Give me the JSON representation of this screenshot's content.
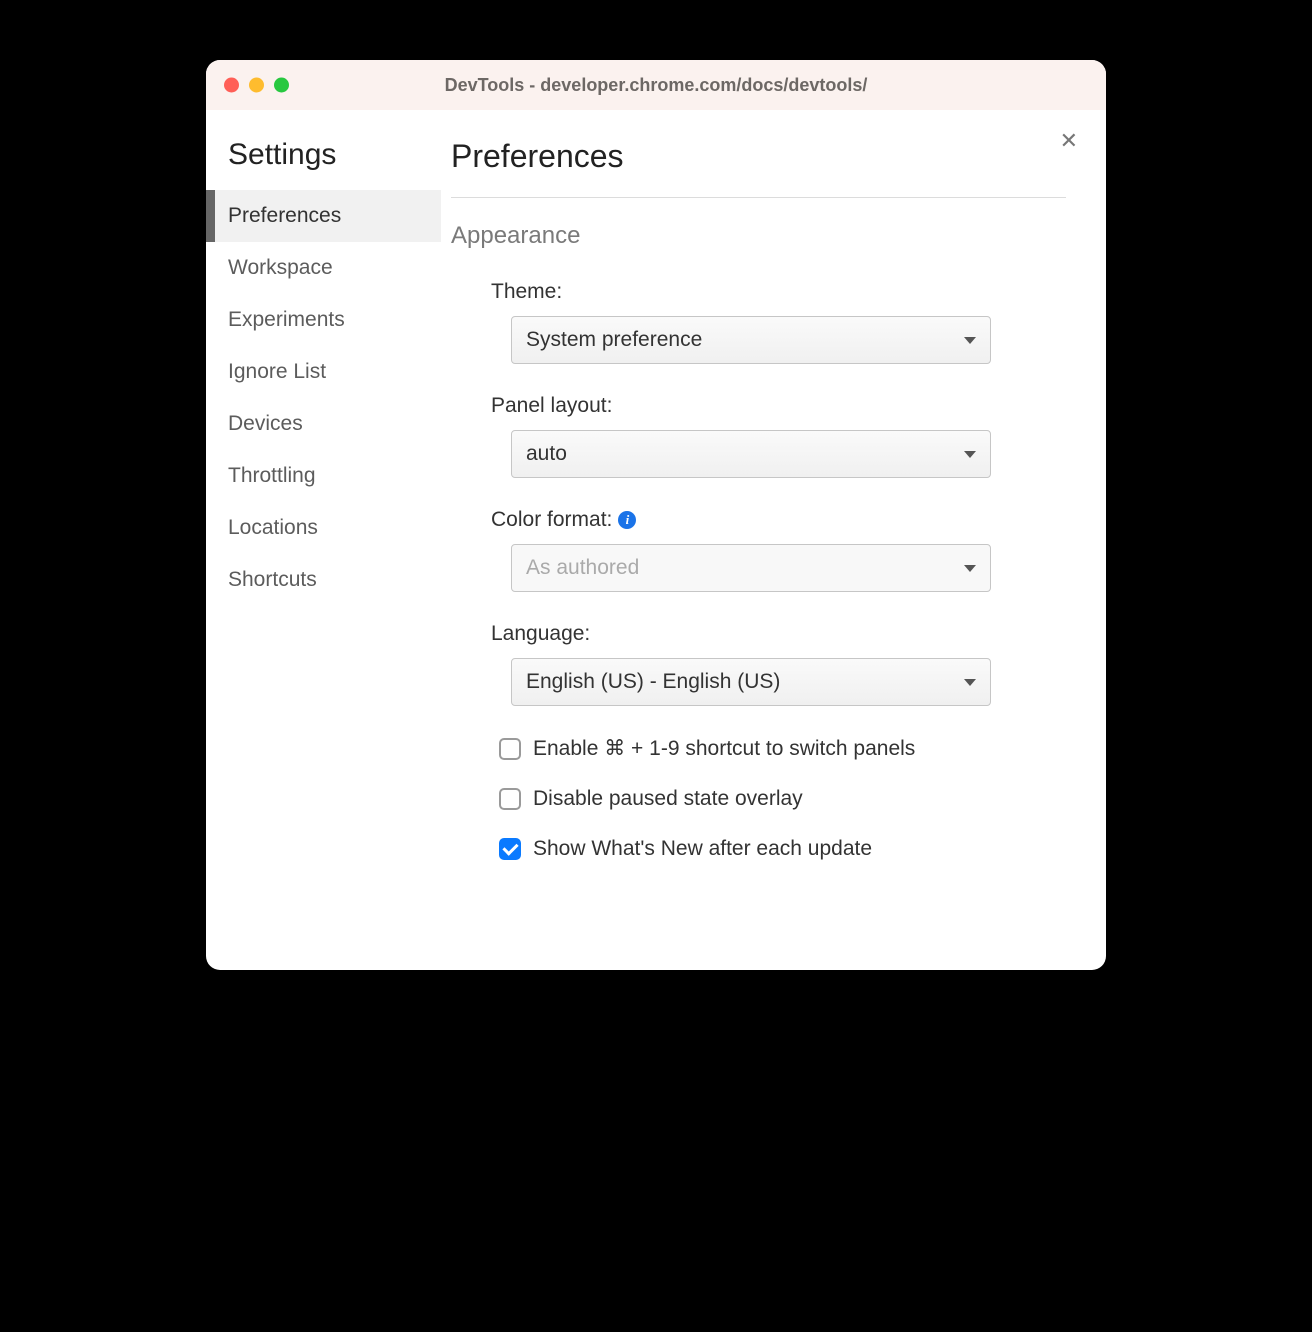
{
  "window": {
    "title": "DevTools - developer.chrome.com/docs/devtools/"
  },
  "sidebar": {
    "title": "Settings",
    "items": [
      {
        "label": "Preferences",
        "active": true
      },
      {
        "label": "Workspace"
      },
      {
        "label": "Experiments"
      },
      {
        "label": "Ignore List"
      },
      {
        "label": "Devices"
      },
      {
        "label": "Throttling"
      },
      {
        "label": "Locations"
      },
      {
        "label": "Shortcuts"
      }
    ]
  },
  "main": {
    "title": "Preferences",
    "section": "Appearance",
    "fields": {
      "theme": {
        "label": "Theme:",
        "value": "System preference"
      },
      "panel_layout": {
        "label": "Panel layout:",
        "value": "auto"
      },
      "color_format": {
        "label": "Color format:",
        "value": "As authored",
        "disabled": true,
        "info": true
      },
      "language": {
        "label": "Language:",
        "value": "English (US) - English (US)"
      }
    },
    "checkboxes": [
      {
        "label": "Enable ⌘ + 1-9 shortcut to switch panels",
        "checked": false
      },
      {
        "label": "Disable paused state overlay",
        "checked": false
      },
      {
        "label": "Show What's New after each update",
        "checked": true
      }
    ]
  }
}
